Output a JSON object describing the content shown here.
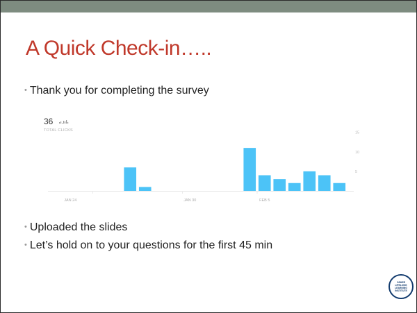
{
  "slide": {
    "title": "A Quick Check-in…..",
    "title_color": "#c0392b",
    "bullets": [
      "Thank you for completing the survey",
      "Uploaded the slides",
      "Let’s hold on to your questions for the first 45 min"
    ]
  },
  "chart": {
    "total_value": "36",
    "total_label": "TOTAL CLICKS",
    "bar_color": "#4cc3f7"
  },
  "chart_data": {
    "type": "bar",
    "series": [
      {
        "values": [
          0,
          0,
          0,
          0,
          0,
          6,
          1,
          0,
          0,
          0,
          0,
          0,
          0,
          11,
          4,
          3,
          2,
          5,
          4,
          2
        ]
      }
    ],
    "x_ticks": [
      "JAN 24",
      "JAN 30",
      "FEB 5"
    ],
    "y_ticks": [
      "5",
      "10",
      "15"
    ],
    "ylim": [
      0,
      16
    ]
  },
  "logo": {
    "text": "OSHER\nLIFELONG\nLEARNING\nINSTITUTE",
    "color": "#123b6e"
  }
}
